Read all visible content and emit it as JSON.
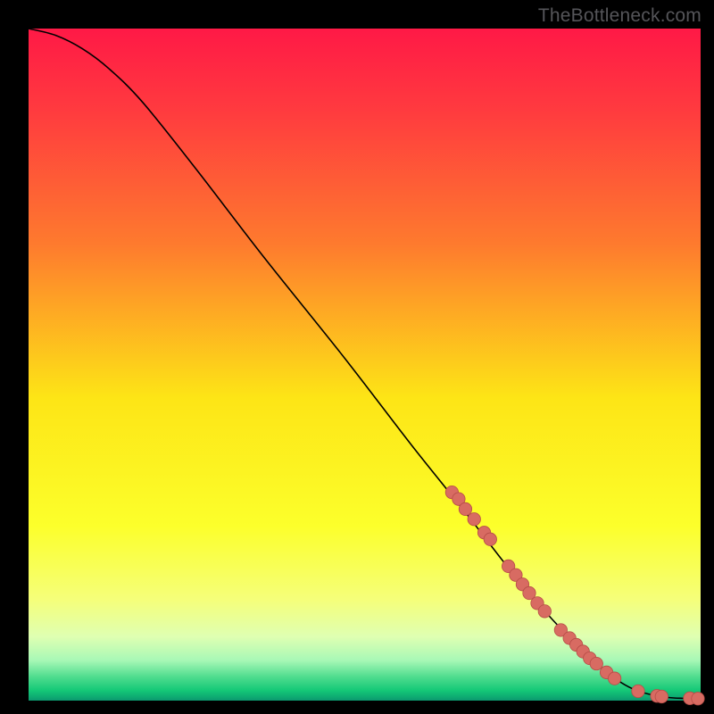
{
  "watermark": "TheBottleneck.com",
  "colors": {
    "frame": "#000000",
    "curve": "#000000",
    "marker_fill": "#d86b62",
    "marker_stroke": "#b64c47",
    "grad_stops": [
      {
        "offset": 0.0,
        "color": "#ff1946"
      },
      {
        "offset": 0.12,
        "color": "#ff3a3f"
      },
      {
        "offset": 0.32,
        "color": "#fe7a2e"
      },
      {
        "offset": 0.55,
        "color": "#fde516"
      },
      {
        "offset": 0.74,
        "color": "#fcff2b"
      },
      {
        "offset": 0.85,
        "color": "#f5ff7a"
      },
      {
        "offset": 0.905,
        "color": "#dfffb2"
      },
      {
        "offset": 0.94,
        "color": "#a8f8b6"
      },
      {
        "offset": 0.965,
        "color": "#4edc8e"
      },
      {
        "offset": 0.985,
        "color": "#14c877"
      },
      {
        "offset": 1.0,
        "color": "#0b996f"
      }
    ]
  },
  "chart_data": {
    "type": "line",
    "title": "",
    "xlabel": "",
    "ylabel": "",
    "xlim": [
      0,
      100
    ],
    "ylim": [
      0,
      100
    ],
    "grid": false,
    "legend": false,
    "curve": [
      {
        "x": 0,
        "y": 100
      },
      {
        "x": 4,
        "y": 99
      },
      {
        "x": 8,
        "y": 97
      },
      {
        "x": 12,
        "y": 94
      },
      {
        "x": 17,
        "y": 89
      },
      {
        "x": 25,
        "y": 79
      },
      {
        "x": 35,
        "y": 66
      },
      {
        "x": 47,
        "y": 51
      },
      {
        "x": 57,
        "y": 38
      },
      {
        "x": 65,
        "y": 28
      },
      {
        "x": 72,
        "y": 19
      },
      {
        "x": 78,
        "y": 12
      },
      {
        "x": 83,
        "y": 7
      },
      {
        "x": 87,
        "y": 3.5
      },
      {
        "x": 90,
        "y": 1.7
      },
      {
        "x": 93,
        "y": 0.8
      },
      {
        "x": 96,
        "y": 0.4
      },
      {
        "x": 100,
        "y": 0.3
      }
    ],
    "markers": [
      {
        "x": 63,
        "y": 31
      },
      {
        "x": 64,
        "y": 30
      },
      {
        "x": 65,
        "y": 28.5
      },
      {
        "x": 66.3,
        "y": 27
      },
      {
        "x": 67.8,
        "y": 25
      },
      {
        "x": 68.7,
        "y": 24
      },
      {
        "x": 71.4,
        "y": 20
      },
      {
        "x": 72.5,
        "y": 18.7
      },
      {
        "x": 73.5,
        "y": 17.3
      },
      {
        "x": 74.5,
        "y": 16
      },
      {
        "x": 75.7,
        "y": 14.5
      },
      {
        "x": 76.8,
        "y": 13.3
      },
      {
        "x": 79.2,
        "y": 10.5
      },
      {
        "x": 80.5,
        "y": 9.3
      },
      {
        "x": 81.5,
        "y": 8.3
      },
      {
        "x": 82.5,
        "y": 7.3
      },
      {
        "x": 83.5,
        "y": 6.3
      },
      {
        "x": 84.5,
        "y": 5.5
      },
      {
        "x": 86.0,
        "y": 4.2
      },
      {
        "x": 87.2,
        "y": 3.3
      },
      {
        "x": 90.7,
        "y": 1.4
      },
      {
        "x": 93.5,
        "y": 0.7
      },
      {
        "x": 94.2,
        "y": 0.6
      },
      {
        "x": 98.4,
        "y": 0.35
      },
      {
        "x": 99.6,
        "y": 0.3
      }
    ]
  }
}
